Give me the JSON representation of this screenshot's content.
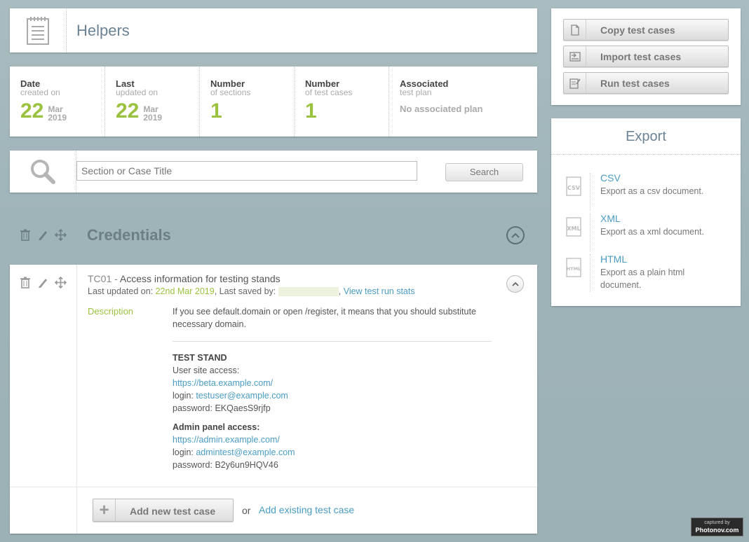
{
  "header": {
    "title": "Helpers"
  },
  "stats": {
    "date_created": {
      "label1": "Date",
      "label2": "created on",
      "day": "22",
      "month": "Mar",
      "year": "2019"
    },
    "last_updated": {
      "label1": "Last",
      "label2": "updated on",
      "day": "22",
      "month": "Mar",
      "year": "2019"
    },
    "sections": {
      "label1": "Number",
      "label2": "of sections",
      "value": "1"
    },
    "test_cases": {
      "label1": "Number",
      "label2": "of test cases",
      "value": "1"
    },
    "plan": {
      "label1": "Associated",
      "label2": "test plan",
      "value": "No associated plan"
    }
  },
  "search": {
    "placeholder": "Section or Case Title",
    "button": "Search"
  },
  "section": {
    "title": "Credentials"
  },
  "case": {
    "id": "TC01",
    "title_sep": " - ",
    "title": "Access information for testing stands",
    "updated_prefix": "Last updated on: ",
    "updated_date": "22nd Mar 2019",
    "saved_prefix": ", Last saved by: ",
    "comma": ",",
    "stats_link": "View test run stats",
    "desc_label": "Description",
    "desc_text": "If you see default.domain or open /register, it means that you should substitute necessary domain.",
    "stand_title": "TEST STAND",
    "user_access": "User site access:",
    "user_url": "https://beta.example.com/",
    "login_label": "login: ",
    "user_login": "testuser@example.com",
    "user_password": "password: EKQaesS9rjfp",
    "admin_access": "Admin panel access:",
    "admin_url": "https://admin.example.com/",
    "admin_login": "admintest@example.com",
    "admin_password": "password: B2y6un9HQV46"
  },
  "bottom": {
    "add_new": "Add new test case",
    "or": "or",
    "add_existing": "Add existing test case"
  },
  "actions": {
    "copy": "Copy test cases",
    "import": "Import test cases",
    "run": "Run test cases"
  },
  "export": {
    "title": "Export",
    "items": [
      {
        "name": "CSV",
        "icon_text": "CSV",
        "desc": "Export as a csv document."
      },
      {
        "name": "XML",
        "icon_text": "XML",
        "desc": "Export as a xml document."
      },
      {
        "name": "HTML",
        "icon_text": "HTML",
        "desc": "Export as a plain html document."
      }
    ]
  },
  "badge": {
    "small": "captured by",
    "big": "Photonov.com"
  },
  "colors": {
    "accent_green": "#9bc23f",
    "link_blue": "#4a9cc4",
    "title_slate": "#6b8394"
  }
}
